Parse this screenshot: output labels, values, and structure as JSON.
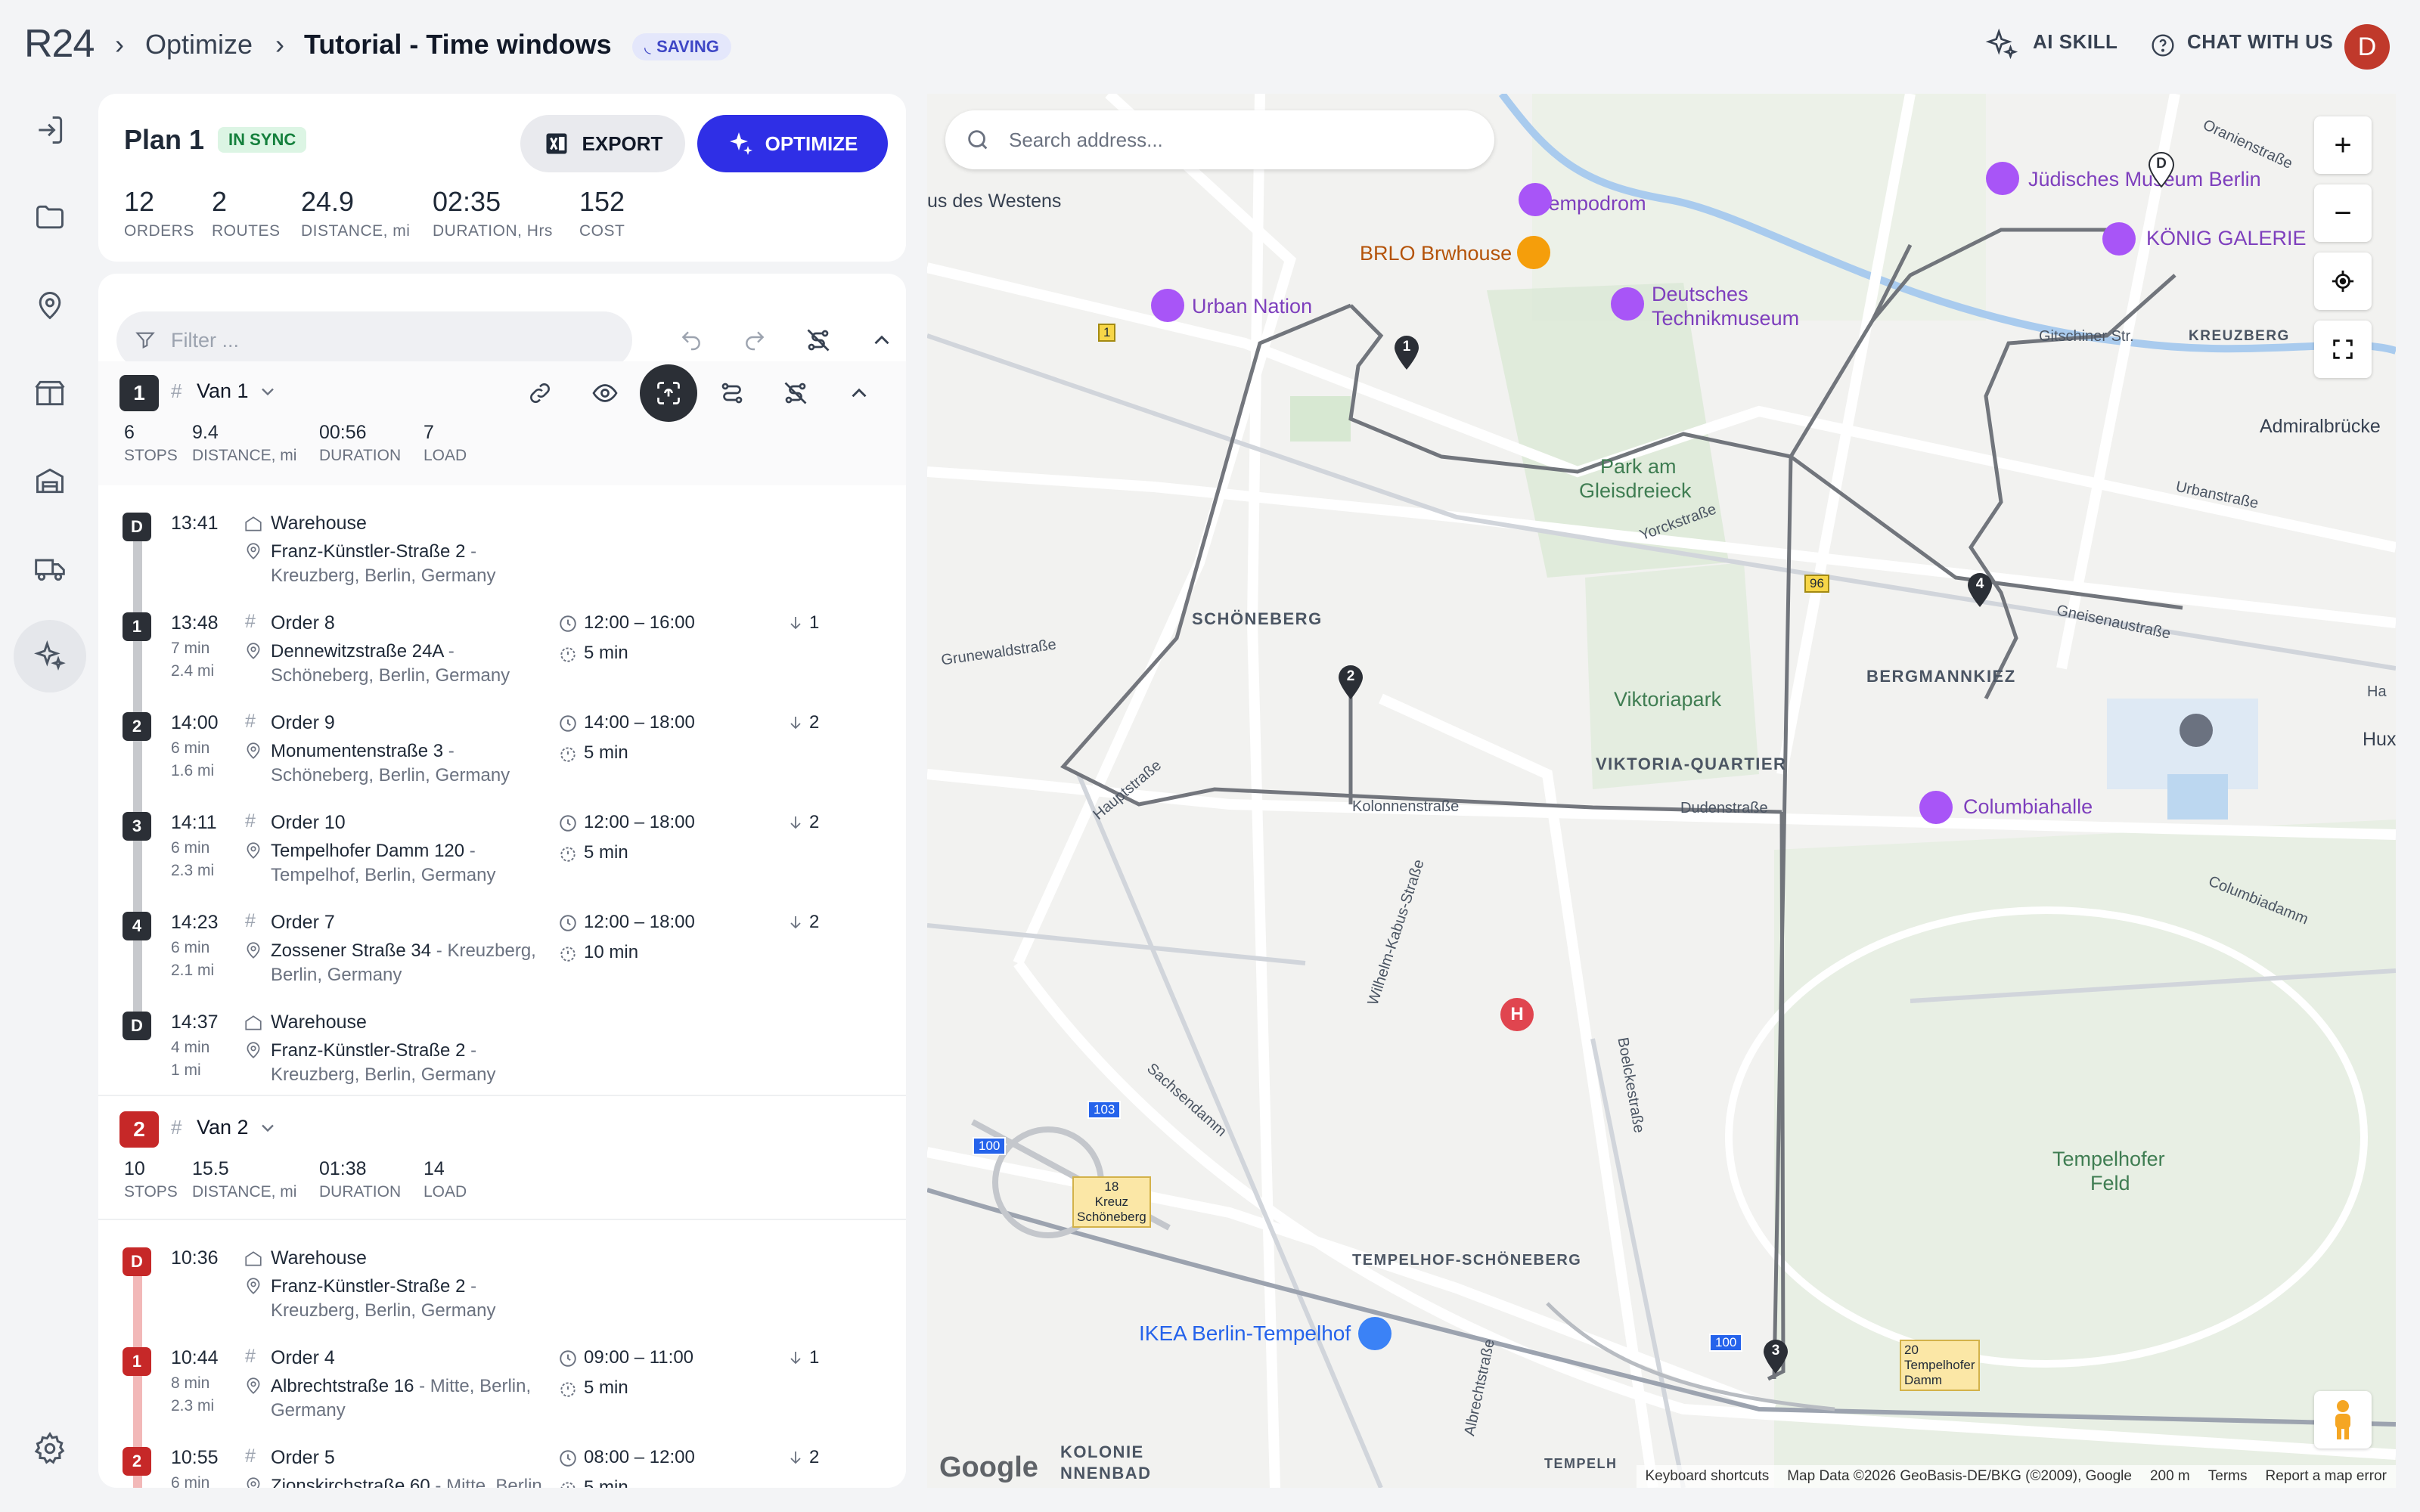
{
  "header": {
    "logo": "R24",
    "crumb_sep": "›",
    "crumb_1": "Optimize",
    "crumb_2": "Tutorial - Time windows",
    "saving_badge": "SAVING",
    "ai_skill": "AI SKILL",
    "chat": "CHAT WITH US",
    "avatar_letter": "D"
  },
  "sidebar": {
    "icons": [
      "sign-in-icon",
      "folder-icon",
      "location-pin-icon",
      "package-icon",
      "warehouse-icon",
      "truck-icon",
      "sparkle-icon",
      "settings-icon"
    ],
    "active": "sparkle-icon"
  },
  "plan": {
    "title": "Plan 1",
    "sync_badge": "IN SYNC",
    "export_label": "EXPORT",
    "optimize_label": "OPTIMIZE",
    "stats": [
      {
        "value": "12",
        "label": "ORDERS"
      },
      {
        "value": "2",
        "label": "ROUTES"
      },
      {
        "value": "24.9",
        "label": "DISTANCE, mi"
      },
      {
        "value": "02:35",
        "label": "DURATION, Hrs"
      },
      {
        "value": "152",
        "label": "COST"
      }
    ]
  },
  "routes_panel": {
    "filter_placeholder": "Filter ..."
  },
  "routes": [
    {
      "number": "1",
      "name": "Van 1",
      "color": "#2b2f36",
      "rail_color": "#c7c9cd",
      "stats": [
        {
          "value": "6",
          "label": "STOPS"
        },
        {
          "value": "9.4",
          "label": "DISTANCE, mi"
        },
        {
          "value": "00:56",
          "label": "DURATION"
        },
        {
          "value": "7",
          "label": "LOAD"
        }
      ],
      "stops": [
        {
          "badge": "D",
          "time": "13:41",
          "sub1": "",
          "sub2": "",
          "name": "Warehouse",
          "street": "Franz-Künstler-Straße 2",
          "city": " - Kreuzberg, Berlin, Germany",
          "window": "",
          "duration": "",
          "load": ""
        },
        {
          "badge": "1",
          "time": "13:48",
          "sub1": "7 min",
          "sub2": "2.4 mi",
          "name": "Order 8",
          "street": "Dennewitzstraße 24A",
          "city": " - Schöneberg, Berlin, Germany",
          "window": "12:00 – 16:00",
          "duration": "5 min",
          "load": "1"
        },
        {
          "badge": "2",
          "time": "14:00",
          "sub1": "6 min",
          "sub2": "1.6 mi",
          "name": "Order 9",
          "street": "Monumentenstraße 3",
          "city": " - Schöneberg, Berlin, Germany",
          "window": "14:00 – 18:00",
          "duration": "5 min",
          "load": "2"
        },
        {
          "badge": "3",
          "time": "14:11",
          "sub1": "6 min",
          "sub2": "2.3 mi",
          "name": "Order 10",
          "street": "Tempelhofer Damm 120",
          "city": " - Tempelhof, Berlin, Germany",
          "window": "12:00 – 18:00",
          "duration": "5 min",
          "load": "2"
        },
        {
          "badge": "4",
          "time": "14:23",
          "sub1": "6 min",
          "sub2": "2.1 mi",
          "name": "Order 7",
          "street": "Zossener Straße 34",
          "city": " - Kreuzberg, Berlin, Germany",
          "window": "12:00 – 18:00",
          "duration": "10 min",
          "load": "2"
        },
        {
          "badge": "D",
          "time": "14:37",
          "sub1": "4 min",
          "sub2": "1 mi",
          "name": "Warehouse",
          "street": "Franz-Künstler-Straße 2",
          "city": " - Kreuzberg, Berlin, Germany",
          "window": "",
          "duration": "",
          "load": ""
        }
      ]
    },
    {
      "number": "2",
      "name": "Van 2",
      "color": "#c62828",
      "rail_color": "#f2b8b8",
      "stats": [
        {
          "value": "10",
          "label": "STOPS"
        },
        {
          "value": "15.5",
          "label": "DISTANCE, mi"
        },
        {
          "value": "01:38",
          "label": "DURATION"
        },
        {
          "value": "14",
          "label": "LOAD"
        }
      ],
      "stops": [
        {
          "badge": "D",
          "time": "10:36",
          "sub1": "",
          "sub2": "",
          "name": "Warehouse",
          "street": "Franz-Künstler-Straße 2",
          "city": " - Kreuzberg, Berlin, Germany",
          "window": "",
          "duration": "",
          "load": ""
        },
        {
          "badge": "1",
          "time": "10:44",
          "sub1": "8 min",
          "sub2": "2.3 mi",
          "name": "Order 4",
          "street": "Albrechtstraße 16",
          "city": " - Mitte, Berlin, Germany",
          "window": "09:00 – 11:00",
          "duration": "5 min",
          "load": "1"
        },
        {
          "badge": "2",
          "time": "10:55",
          "sub1": "6 min",
          "sub2": "",
          "name": "Order 5",
          "street": "Zionskirchstraße 60",
          "city": " - Mitte, Berlin,",
          "window": "08:00 – 12:00",
          "duration": "5 min",
          "load": "2"
        }
      ]
    }
  ],
  "map": {
    "search_placeholder": "Search address...",
    "zoom_in": "+",
    "zoom_out": "−",
    "labels": {
      "tempodrom": "Tempodrom",
      "brlo": "BRLO Brwhouse",
      "urban_nation": "Urban Nation",
      "technikmuseum_1": "Deutsches",
      "technikmuseum_2": "Technikmuseum",
      "juedisches": "Jüdisches Museum Berlin",
      "koenig": "KÖNIG GALERIE",
      "park_1": "Park am",
      "park_2": "Gleisdreieck",
      "schoeneberg": "SCHÖNEBERG",
      "bergmannkiez": "BERGMANNKIEZ",
      "viktoriapark": "Viktoriapark",
      "viktoria_quartier": "VIKTORIA-QUARTIER",
      "columbiahalle": "Columbiahalle",
      "tempelhof_schoeneberg": "TEMPELHOF-SCHÖNEBERG",
      "ikea": "IKEA Berlin-Tempelhof",
      "tempelhofer_feld_1": "Tempelhofer",
      "tempelhofer_feld_2": "Feld",
      "kolonie_1": "KOLONIE",
      "kolonie_2": "NNENBAD",
      "westens": "us des Westens",
      "kreuzberg": "KREUZBERG",
      "admiral": "Admiralbrücke",
      "hux": "Hux",
      "ha": "Ha",
      "gitschiner": "Gitschiner Str.",
      "urbanstr": "Urbanstraße",
      "gneisenau": "Gneisenaustraße",
      "yorck": "Yorckstraße",
      "grunewald": "Grunewaldstraße",
      "haupt": "Hauptstraße",
      "kolonnen": "Kolonnenstraße",
      "duden": "Dudenstraße",
      "wilhelm": "Wilhelm-Kabus-Straße",
      "sachsendamm": "Sachsendamm",
      "boelcke": "Boelckestraße",
      "albrecht": "Albrechtstraße",
      "columbiadamm": "Columbiadamm",
      "oranienstr": "Oranienstraße",
      "kreuz_1": "Kreuz",
      "kreuz_2": "Schöneberg",
      "tdamm_1": "Tempelhofer",
      "tdamm_2": "Damm",
      "r18": "18",
      "r20": "20",
      "r96": "96",
      "r1": "1",
      "r100": "100",
      "r103": "103",
      "r100b": "100",
      "tempelh_cut": "TEMPELH"
    },
    "markers": [
      {
        "label": "1",
        "color": "#2b2f36"
      },
      {
        "label": "2",
        "color": "#2b2f36"
      },
      {
        "label": "3",
        "color": "#2b2f36"
      },
      {
        "label": "4",
        "color": "#2b2f36"
      },
      {
        "label": "D",
        "color": "#ffffff"
      }
    ],
    "footer": {
      "google": "Google",
      "shortcuts": "Keyboard shortcuts",
      "mapdata": "Map Data ©2026 GeoBasis-DE/BKG (©2009), Google",
      "scale": "200 m",
      "terms": "Terms",
      "report": "Report a map error"
    }
  }
}
